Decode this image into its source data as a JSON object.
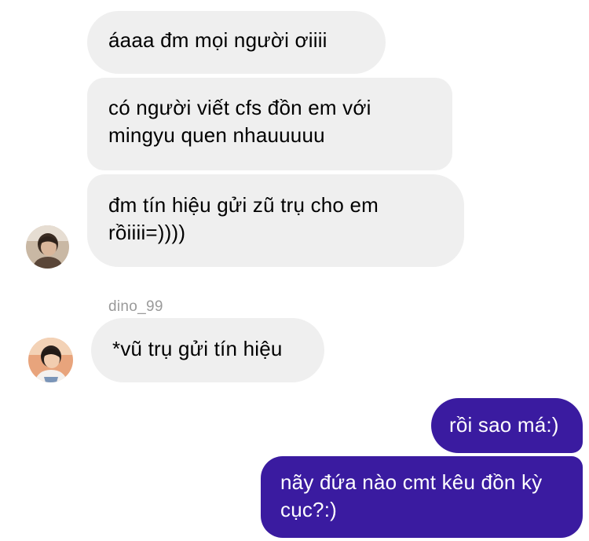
{
  "thread": {
    "messages": [
      {
        "sender": "",
        "text": "áaaa đm mọi người ơiiii",
        "direction": "incoming"
      },
      {
        "sender": "",
        "text": "có người viết cfs đồn em với mingyu quen nhauuuuu",
        "direction": "incoming"
      },
      {
        "sender": "",
        "text": "đm tín hiệu gửi zũ trụ cho em rồiiii=))))",
        "direction": "incoming"
      },
      {
        "sender": "dino_99",
        "text": "*vũ trụ gửi tín hiệu",
        "direction": "incoming"
      },
      {
        "sender": "",
        "text": "rồi sao má:)",
        "direction": "outgoing"
      },
      {
        "sender": "",
        "text": "nãy đứa nào cmt kêu đồn kỳ cục?:)",
        "direction": "outgoing"
      }
    ],
    "username_label": "dino_99"
  },
  "colors": {
    "incoming_bubble": "#efefef",
    "outgoing_bubble": "#3a1ba0",
    "username_text": "#9a9a9a"
  },
  "icons": {
    "avatar_1": "user-avatar-photo",
    "avatar_2": "user-avatar-photo"
  }
}
